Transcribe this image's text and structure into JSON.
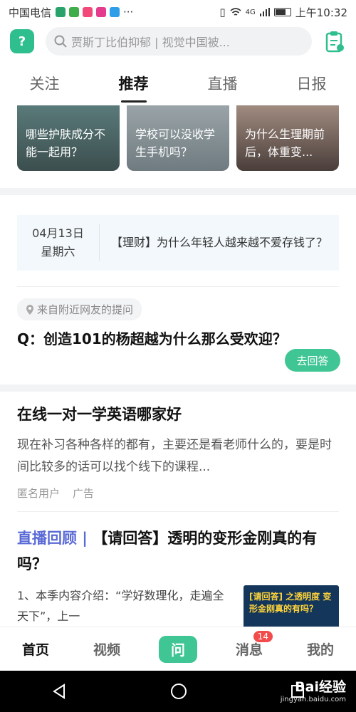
{
  "status_bar": {
    "carrier": "中国电信",
    "network": "4G",
    "time": "上午10:32"
  },
  "header": {
    "search_placeholder": "贾斯丁比伯抑郁 | 视觉中国被..."
  },
  "tabs": [
    {
      "label": "关注",
      "active": false
    },
    {
      "label": "推荐",
      "active": true
    },
    {
      "label": "直播",
      "active": false
    },
    {
      "label": "日报",
      "active": false
    }
  ],
  "cards": [
    {
      "title": "哪些护肤成分不能一起用？"
    },
    {
      "title": "学校可以没收学生手机吗？"
    },
    {
      "title": "为什么生理期前后，体重变..."
    }
  ],
  "daily": {
    "date": "04月13日",
    "weekday": "星期六",
    "headline": "【理财】为什么年轻人越来越不爱存钱了？"
  },
  "question": {
    "source": "来自附近网友的提问",
    "title": "Q：创造101的杨超越为什么那么受欢迎？",
    "answer_button": "去回答"
  },
  "ad": {
    "title": "在线一对一学英语哪家好",
    "description": "现在补习各种各样的都有，主要还是看老师什么的，要是时间比较多的话可以找个线下的课程...",
    "author": "匿名用户",
    "tag": "广告"
  },
  "live": {
    "tag": "直播回顾 |",
    "title": "【请回答】透明的变形金刚真的有吗？",
    "description": "1、本季内容介绍：“学好数理化，走遍全天下”，上一",
    "thumb_text": "[请回答] 之透明度 变形金刚真的有吗？"
  },
  "bottom_nav": [
    {
      "label": "首页",
      "active": true
    },
    {
      "label": "视频",
      "active": false
    },
    {
      "label": "问",
      "active": false
    },
    {
      "label": "消息",
      "active": false,
      "badge": "14"
    },
    {
      "label": "我的",
      "active": false
    }
  ],
  "watermark": {
    "text": "Bai经验",
    "url": "jingyan.baidu.com"
  },
  "colors": {
    "accent": "#3fc694",
    "live_tag": "#5a6ad6",
    "badge": "#f24b4b"
  }
}
